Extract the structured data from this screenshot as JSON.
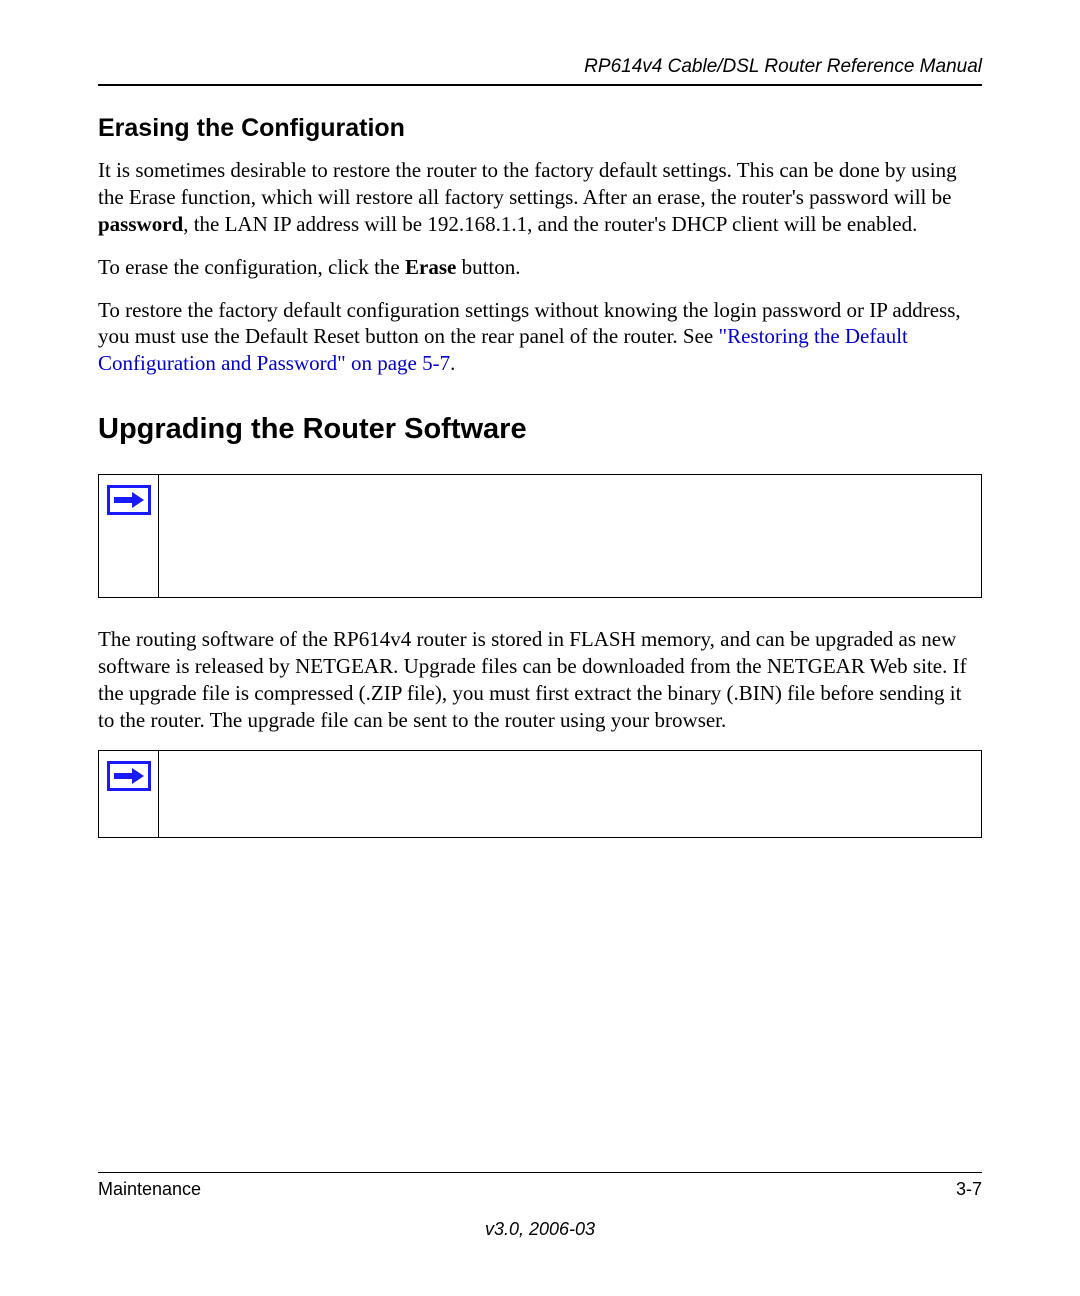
{
  "header": {
    "doc_title": "RP614v4 Cable/DSL Router Reference Manual"
  },
  "section1": {
    "heading": "Erasing the Configuration",
    "p1_a": "It is sometimes desirable to restore the router to the factory default settings. This can be done by using the Erase function, which will restore all factory settings. After an erase, the router's password will be ",
    "p1_bold1": "password",
    "p1_b": ", the LAN IP address will be 192.168.1.1, and the router's DHCP client will be enabled.",
    "p2_a": "To erase the configuration, click the ",
    "p2_bold1": "Erase",
    "p2_b": " button.",
    "p3_a": "To restore the factory default configuration settings without knowing the login password or IP address, you must use the Default Reset button on the rear panel of the router. See ",
    "p3_link": "\"Restoring the Default Configuration and Password\" on page 5-7",
    "p3_b": "."
  },
  "section2": {
    "heading": "Upgrading the Router Software",
    "p1": "The routing software of the RP614v4 router is stored in FLASH memory, and can be upgraded as new software is released by NETGEAR. Upgrade files can be downloaded from the NETGEAR Web site. If the upgrade file is compressed (.ZIP file), you must first extract the binary (.BIN) file before sending it to the router. The upgrade file can be sent to the router using your browser."
  },
  "footer": {
    "chapter": "Maintenance",
    "page": "3-7",
    "version": "v3.0, 2006-03"
  }
}
